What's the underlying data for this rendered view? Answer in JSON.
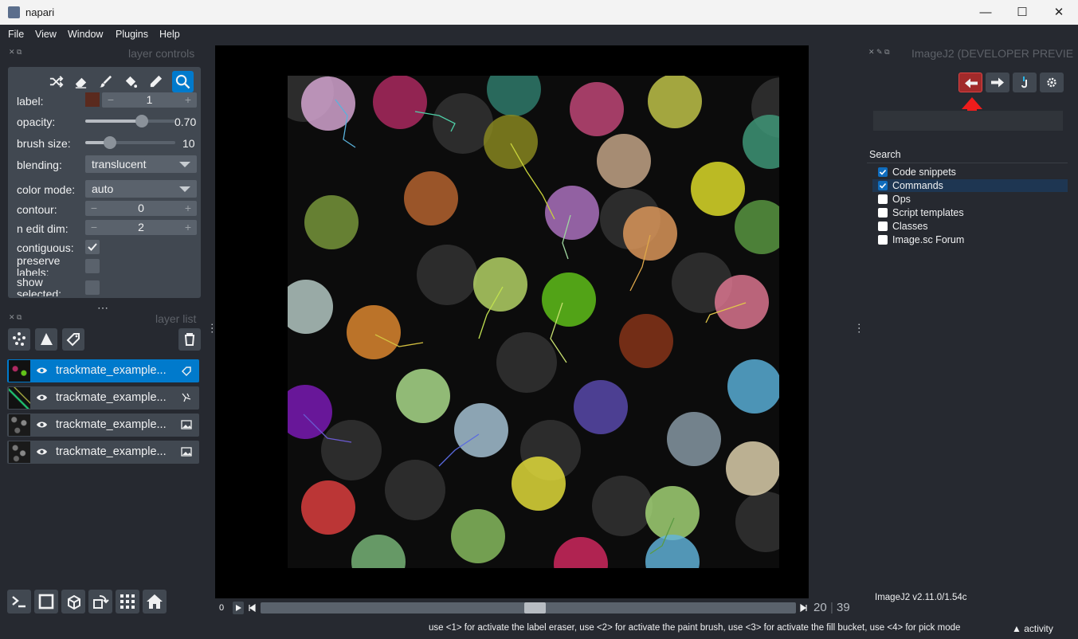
{
  "app": {
    "title": "napari"
  },
  "window_controls": {
    "minimize": "—",
    "maximize": "☐",
    "close": "✕"
  },
  "menu": [
    "File",
    "View",
    "Window",
    "Plugins",
    "Help"
  ],
  "layer_controls": {
    "title": "layer controls",
    "tools": [
      "shuffle-icon",
      "eraser-icon",
      "paint-brush-icon",
      "fill-bucket-icon",
      "pick-icon",
      "zoom-icon"
    ],
    "label": {
      "label": "label:",
      "value": "1",
      "color": "#5a2a1e"
    },
    "opacity": {
      "label": "opacity:",
      "value": "0.70",
      "fraction": 0.7
    },
    "brush_size": {
      "label": "brush size:",
      "value": "10",
      "fraction": 0.2
    },
    "blending": {
      "label": "blending:",
      "value": "translucent"
    },
    "color_mode": {
      "label": "color mode:",
      "value": "auto"
    },
    "contour": {
      "label": "contour:",
      "value": "0"
    },
    "n_edit_dim": {
      "label": "n edit dim:",
      "value": "2"
    },
    "contiguous": {
      "label": "contiguous:",
      "checked": true
    },
    "preserve_labels": {
      "label": "preserve\nlabels:",
      "checked": false
    },
    "show_selected": {
      "label": "show\nselected:",
      "checked": false
    }
  },
  "layer_list": {
    "title": "layer list",
    "layers": [
      {
        "name": "trackmate_example...",
        "type": "labels-icon",
        "selected": true
      },
      {
        "name": "trackmate_example...",
        "type": "tracks-icon",
        "selected": false
      },
      {
        "name": "trackmate_example...",
        "type": "image-icon",
        "selected": false
      },
      {
        "name": "trackmate_example...",
        "type": "image-icon",
        "selected": false
      }
    ]
  },
  "dims": {
    "start": "0",
    "current": "20",
    "total": "39"
  },
  "right_panel": {
    "title": "ImageJ2 (DEVELOPER PREVIE",
    "search_header": "Search",
    "search_items": [
      {
        "label": "Code snippets",
        "checked": true
      },
      {
        "label": "Commands",
        "checked": true
      },
      {
        "label": "Ops",
        "checked": false
      },
      {
        "label": "Script templates",
        "checked": false
      },
      {
        "label": "Classes",
        "checked": false
      },
      {
        "label": "Image.sc Forum",
        "checked": false
      }
    ],
    "version": "ImageJ2 v2.11.0/1.54c"
  },
  "status": {
    "message": "use <1> for activate the label eraser, use <2> for activate the paint brush, use <3> for activate the fill bucket, use <4> for pick mode",
    "activity": "activity"
  },
  "cells": [
    {
      "color": "#d9a8d6"
    },
    {
      "color": "#b02a62"
    },
    {
      "color": "#2f7e6e"
    },
    {
      "color": "#c5487a"
    },
    {
      "color": "#c4c84a"
    },
    {
      "color": "#8b8a20"
    },
    {
      "color": "#c8a88a"
    },
    {
      "color": "#3f9a7a"
    },
    {
      "color": "#e2e02a"
    },
    {
      "color": "#b9652f"
    },
    {
      "color": "#7a9a3c"
    },
    {
      "color": "#b074c3"
    },
    {
      "color": "#e09a5c"
    },
    {
      "color": "#b8d868"
    },
    {
      "color": "#62c41a"
    },
    {
      "color": "#e07892"
    },
    {
      "color": "#b8cdc8"
    },
    {
      "color": "#e28a2f"
    },
    {
      "color": "#8a3418"
    },
    {
      "color": "#7c1ab8"
    },
    {
      "color": "#aee08e"
    },
    {
      "color": "#a8c6d8"
    },
    {
      "color": "#5a4ab0"
    },
    {
      "color": "#5ab2dc"
    },
    {
      "color": "#8a9ca8"
    },
    {
      "color": "#e2d4b0"
    },
    {
      "color": "#e24040"
    },
    {
      "color": "#e6e03a"
    },
    {
      "color": "#a6d878"
    },
    {
      "color": "#8ac060"
    },
    {
      "color": "#d42860"
    },
    {
      "color": "#62b4dc"
    },
    {
      "color": "#7ab87a"
    },
    {
      "color": "#5a9a42"
    }
  ]
}
